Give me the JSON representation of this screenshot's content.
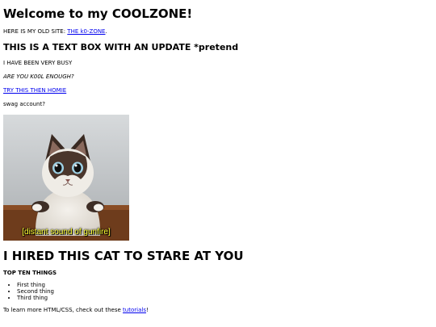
{
  "header": {
    "title": "Welcome to my COOLZONE!"
  },
  "old_site": {
    "prefix": "HERE IS MY OLD SITE: ",
    "link_text": "THE k0-ZONE",
    "suffix": "."
  },
  "update": {
    "heading": "THIS IS A TEXT BOX WITH AN UPDATE *pretend",
    "busy_text": "I HAVE BEEN VERY BUSY",
    "kool_text": "ARE YOU K00L ENOUGH?",
    "try_link": "TRY THIS THEN HOMIE",
    "swag_text": "swag account?"
  },
  "cat": {
    "caption": "[distant sound of gunfire]",
    "heading": "I HIRED THIS CAT TO STARE AT YOU"
  },
  "top_ten": {
    "title": "TOP TEN THINGS",
    "items": [
      "First thing",
      "Second thing",
      "Third thing"
    ]
  },
  "footer": {
    "prefix": "To learn more HTML/CSS, check out these ",
    "link_text": "tutorials",
    "suffix": "!"
  },
  "colors": {
    "link": "#0000ee",
    "caption": "#ffff33"
  }
}
